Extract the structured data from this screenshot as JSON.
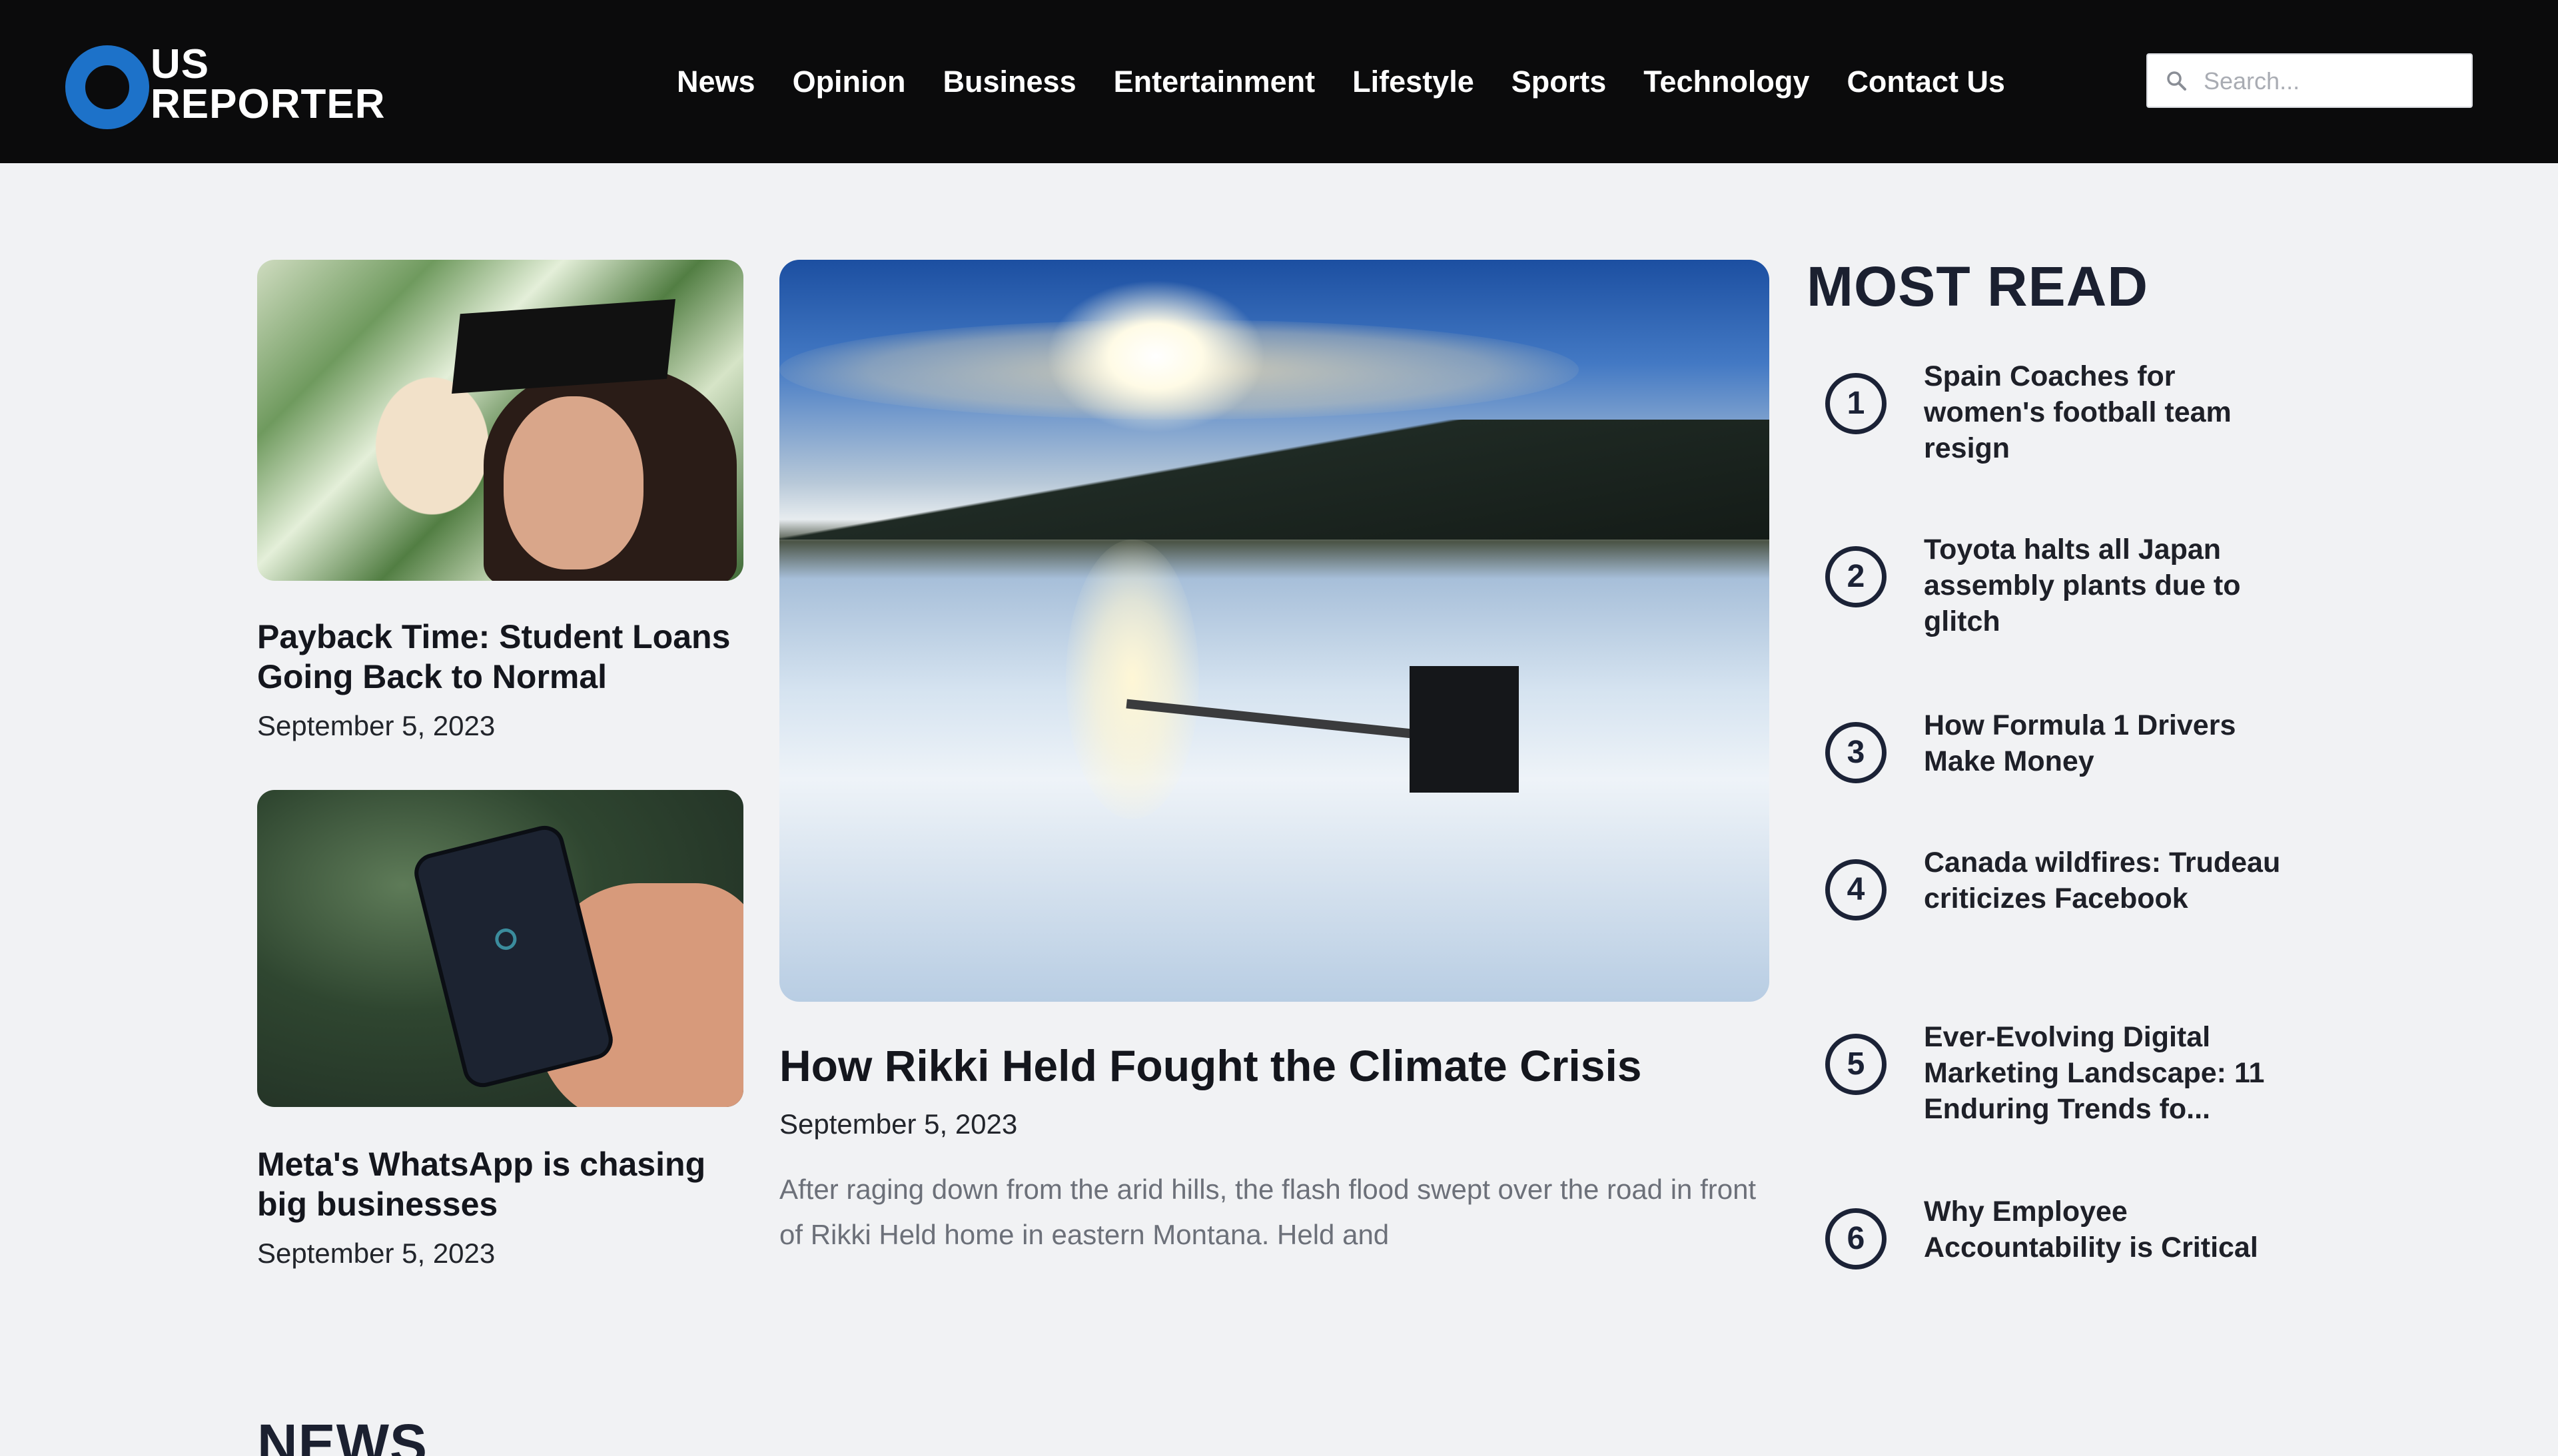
{
  "brand": {
    "logo_line1": "US",
    "logo_line2": "REPORTER",
    "accent_color": "#1d72c9"
  },
  "nav": {
    "items": [
      "News",
      "Opinion",
      "Business",
      "Entertainment",
      "Lifestyle",
      "Sports",
      "Technology",
      "Contact Us"
    ]
  },
  "search": {
    "placeholder": "Search...",
    "icon": "search-icon"
  },
  "left_cards": [
    {
      "title": "Payback Time: Student Loans Going Back to Normal",
      "date": "September 5, 2023",
      "image": "money-graduate-image"
    },
    {
      "title": "Meta's WhatsApp is chasing big businesses",
      "date": "September 5, 2023",
      "image": "hand-phone-image"
    }
  ],
  "hero": {
    "title": "How Rikki Held Fought the Climate Crisis",
    "date": "September 5, 2023",
    "excerpt": "After raging down from the arid hills, the flash flood swept over the road in front of Rikki Held home in eastern Montana. Held and",
    "image": "frozen-lake-image"
  },
  "most_read": {
    "heading": "MOST READ",
    "items": [
      {
        "num": "1",
        "title": "Spain Coaches for women's football team resign"
      },
      {
        "num": "2",
        "title": "Toyota halts all Japan assembly plants due to glitch"
      },
      {
        "num": "3",
        "title": "How Formula 1 Drivers Make Money"
      },
      {
        "num": "4",
        "title": "Canada wildfires: Trudeau criticizes Facebook"
      },
      {
        "num": "5",
        "title": "Ever-Evolving Digital Marketing Landscape: 11 Enduring Trends fo..."
      },
      {
        "num": "6",
        "title": "Why Employee Accountability is Critical"
      }
    ]
  },
  "news_section": {
    "heading": "NEWS"
  }
}
